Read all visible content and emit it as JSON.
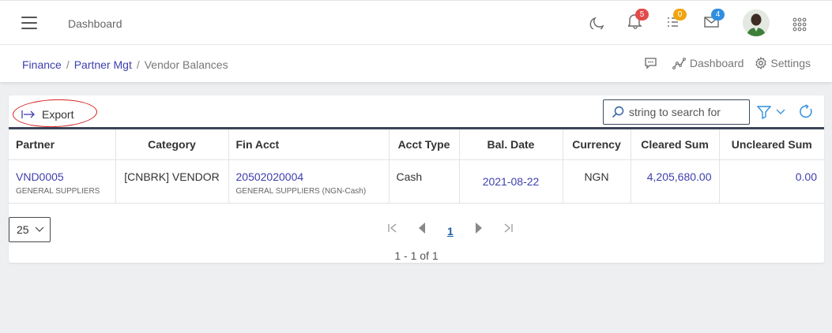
{
  "header": {
    "title": "Dashboard",
    "notifications_count": "5",
    "tasks_count": "0",
    "messages_count": "4",
    "badge_colors": {
      "notifications": "#e34a4a",
      "tasks": "#f0a40e",
      "messages": "#2f8ee0"
    }
  },
  "breadcrumb": {
    "items": [
      "Finance",
      "Partner Mgt",
      "Vendor Balances"
    ],
    "actions": {
      "dashboard": "Dashboard",
      "settings": "Settings"
    }
  },
  "toolbar": {
    "export_label": "Export",
    "search_placeholder": "string to search for"
  },
  "table": {
    "columns": [
      "Partner",
      "Category",
      "Fin Acct",
      "Acct Type",
      "Bal. Date",
      "Currency",
      "Cleared Sum",
      "Uncleared Sum"
    ],
    "rows": [
      {
        "partner": "VND0005",
        "partner_sub": "GENERAL SUPPLIERS",
        "category": "[CNBRK] VENDOR",
        "fin_acct": "20502020004",
        "fin_acct_sub": "GENERAL SUPPLIERS (NGN-Cash)",
        "acct_type": "Cash",
        "bal_date": "2021-08-22",
        "currency": "NGN",
        "cleared_sum": "4,205,680.00",
        "uncleared_sum": "0.00"
      }
    ]
  },
  "pagination": {
    "page_size": "25",
    "current_page": "1",
    "info": "1 - 1 of 1"
  },
  "colors": {
    "link": "#3d3fad",
    "accent": "#1c5fa8",
    "export_highlight": "#d62020"
  }
}
